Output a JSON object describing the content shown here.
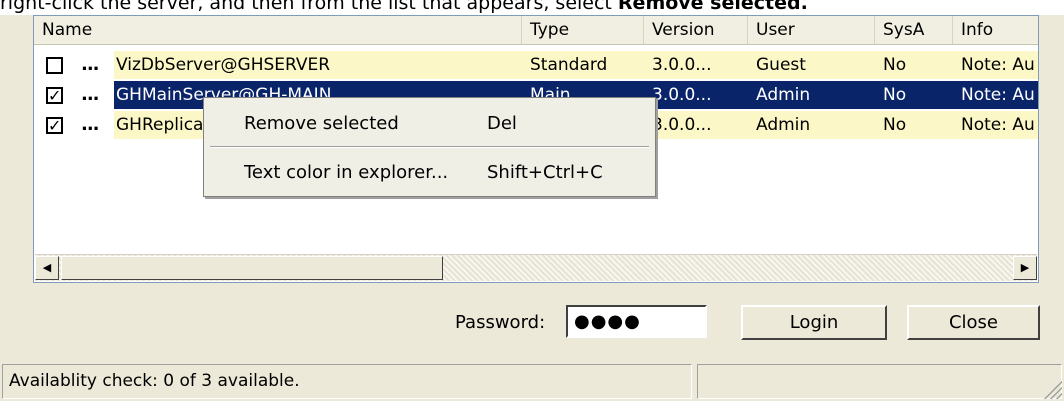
{
  "instruction": {
    "prefix": "right-click the server, and then from the list that appears, select ",
    "bold": "Remove selected."
  },
  "columns": [
    "Name",
    "Type",
    "Version",
    "User",
    "SysA",
    "Info"
  ],
  "rows": [
    {
      "checked": "",
      "dots": "...",
      "name": "VizDbServer@GHSERVER",
      "type": "Standard",
      "version": "3.0.0...",
      "user": "Guest",
      "sysa": "No",
      "info": "Note: Au"
    },
    {
      "checked": "✓",
      "dots": "...",
      "name": "GHMainServer@GH-MAIN",
      "type": "Main",
      "version": "3.0.0...",
      "user": "Admin",
      "sysa": "No",
      "info": "Note: Au"
    },
    {
      "checked": "✓",
      "dots": "...",
      "name": "GHReplica",
      "type": "",
      "version": "3.0.0...",
      "user": "Admin",
      "sysa": "No",
      "info": "Note: Au"
    }
  ],
  "context_menu": {
    "items": [
      {
        "label": "Remove selected",
        "shortcut": "Del"
      },
      {
        "label": "Text color in explorer...",
        "shortcut": "Shift+Ctrl+C"
      }
    ]
  },
  "scroll": {
    "left_icon": "◀",
    "right_icon": "▶"
  },
  "password": {
    "label": "Password:",
    "value": "●●●●"
  },
  "buttons": {
    "login": "Login",
    "close": "Close"
  },
  "status": {
    "text": "Availablity check: 0 of 3 available.",
    "panel2": ""
  },
  "colors": {
    "selection": "#0a246a",
    "highlight_row": "#fbf7c6",
    "window_bg": "#ece9d8"
  }
}
